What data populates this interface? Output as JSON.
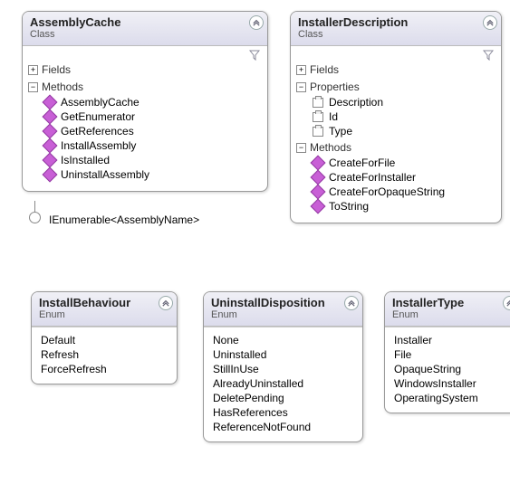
{
  "classes": [
    {
      "id": "assemblycache",
      "name": "AssemblyCache",
      "stereotype": "Class",
      "hasFilter": true,
      "sections": {
        "fields": {
          "label": "Fields",
          "expanded": false
        },
        "methods": {
          "label": "Methods",
          "expanded": true,
          "items": [
            "AssemblyCache",
            "GetEnumerator",
            "GetReferences",
            "InstallAssembly",
            "IsInstalled",
            "UninstallAssembly"
          ]
        }
      },
      "implements": "IEnumerable<AssemblyName>"
    },
    {
      "id": "installerdescription",
      "name": "InstallerDescription",
      "stereotype": "Class",
      "hasFilter": true,
      "sections": {
        "fields": {
          "label": "Fields",
          "expanded": false
        },
        "properties": {
          "label": "Properties",
          "expanded": true,
          "items": [
            "Description",
            "Id",
            "Type"
          ]
        },
        "methods": {
          "label": "Methods",
          "expanded": true,
          "items": [
            "CreateForFile",
            "CreateForInstaller",
            "CreateForOpaqueString",
            "ToString"
          ]
        }
      }
    }
  ],
  "enums": [
    {
      "id": "installbehaviour",
      "name": "InstallBehaviour",
      "stereotype": "Enum",
      "values": [
        "Default",
        "Refresh",
        "ForceRefresh"
      ]
    },
    {
      "id": "uninstalldisposition",
      "name": "UninstallDisposition",
      "stereotype": "Enum",
      "values": [
        "None",
        "Uninstalled",
        "StillInUse",
        "AlreadyUninstalled",
        "DeletePending",
        "HasReferences",
        "ReferenceNotFound"
      ]
    },
    {
      "id": "installertype",
      "name": "InstallerType",
      "stereotype": "Enum",
      "values": [
        "Installer",
        "File",
        "OpaqueString",
        "WindowsInstaller",
        "OperatingSystem"
      ]
    }
  ]
}
